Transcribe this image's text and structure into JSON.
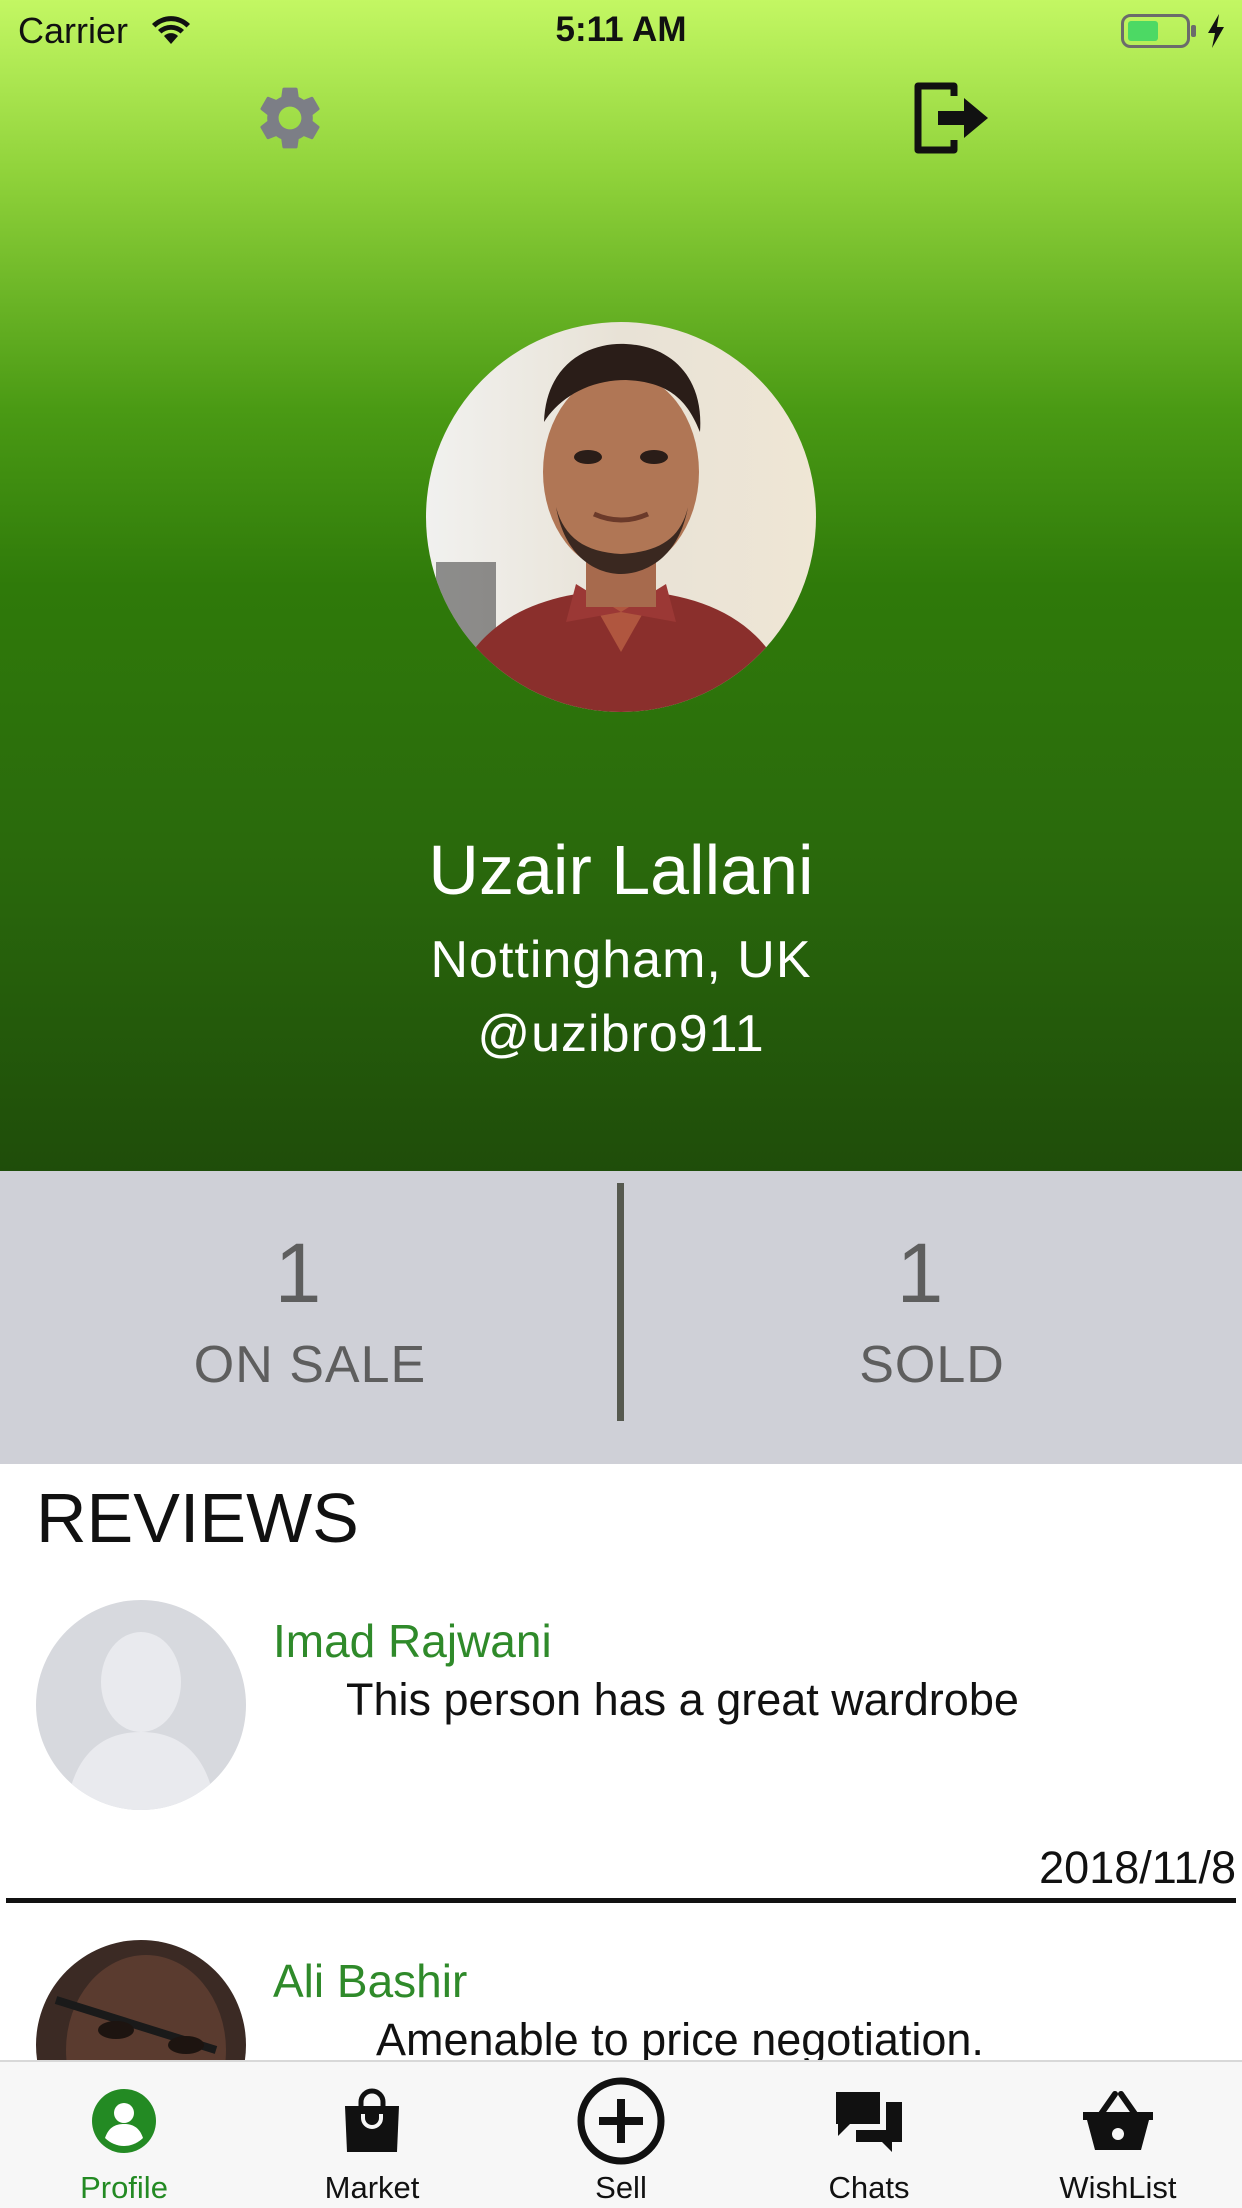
{
  "status_bar": {
    "carrier": "Carrier",
    "time": "5:11 AM",
    "battery_color": "#4cd964"
  },
  "header": {
    "settings_icon": "gear-icon",
    "logout_icon": "logout-icon"
  },
  "profile": {
    "name": "Uzair Lallani",
    "location": "Nottingham, UK",
    "handle": "@uzibro911"
  },
  "stats": {
    "on_sale": {
      "value": "1",
      "label": "ON SALE"
    },
    "sold": {
      "value": "1",
      "label": "SOLD"
    }
  },
  "reviews": {
    "title": "REVIEWS",
    "items": [
      {
        "author": "Imad Rajwani",
        "text": "This person has a great wardrobe",
        "date": "2018/11/8"
      },
      {
        "author": "Ali Bashir",
        "text": "Amenable to price negotiation."
      }
    ]
  },
  "tabbar": {
    "active_color": "#238a23",
    "tabs": [
      {
        "label": "Profile",
        "icon": "profile-icon",
        "active": true
      },
      {
        "label": "Market",
        "icon": "shopping-bag-icon",
        "active": false
      },
      {
        "label": "Sell",
        "icon": "plus-circle-icon",
        "active": false
      },
      {
        "label": "Chats",
        "icon": "chat-bubbles-icon",
        "active": false
      },
      {
        "label": "WishList",
        "icon": "basket-icon",
        "active": false
      }
    ]
  },
  "colors": {
    "accent_green": "#2f8a2a",
    "stats_bg": "#cfd0d7"
  }
}
